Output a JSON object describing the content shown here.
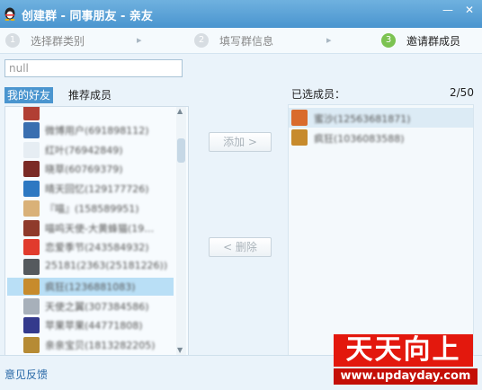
{
  "window": {
    "title": "创建群 - 同事朋友 - 亲友",
    "min_glyph": "—",
    "close_glyph": "✕"
  },
  "steps": [
    {
      "num": "1",
      "label": "选择群类别"
    },
    {
      "num": "2",
      "label": "填写群信息"
    },
    {
      "num": "3",
      "label": "邀请群成员"
    }
  ],
  "step_arrow": "▸",
  "search": {
    "value": "null"
  },
  "tabs": {
    "friends": "我的好友",
    "recommend": "推荐成员"
  },
  "friends": [
    {
      "name": "",
      "color": "#b13f34"
    },
    {
      "name": "微博用户(691898112)",
      "color": "#3a6fb0"
    },
    {
      "name": "红叶(76942849)",
      "color": "#e6edf3"
    },
    {
      "name": "晓草(60769379)",
      "color": "#7b2a25"
    },
    {
      "name": "晴天回忆(129177726)",
      "color": "#2d78c2"
    },
    {
      "name": "『喵』(158589951)",
      "color": "#d9b178"
    },
    {
      "name": "喵呜天使-大黄蜂猫(19…",
      "color": "#8f3a2b"
    },
    {
      "name": "恋爱季节(243584932)",
      "color": "#e13b2d"
    },
    {
      "name": "25181(2363(25181226))",
      "color": "#555a5e"
    },
    {
      "name": "疯狂(1236881083)",
      "color": "#c78b2c"
    },
    {
      "name": "天使之翼(307384586)",
      "color": "#a7b0ba"
    },
    {
      "name": "苹果苹果(44771808)",
      "color": "#343a8c"
    },
    {
      "name": "亲亲宝贝(1813282205)",
      "color": "#b68b34"
    }
  ],
  "buttons": {
    "add": "添加 >",
    "remove": "< 删除"
  },
  "selected": {
    "label": "已选成员：",
    "count": "2/50",
    "members": [
      {
        "name": "蜜沙(12563681871)",
        "color": "#d96b2c"
      },
      {
        "name": "疯狂(1036083588)",
        "color": "#c78b2c"
      }
    ]
  },
  "footer": {
    "feedback": "意见反馈"
  },
  "watermark": {
    "title": "天天向上",
    "url": "www.updayday.com"
  },
  "scroll": {
    "up": "▲",
    "down": "▼"
  }
}
